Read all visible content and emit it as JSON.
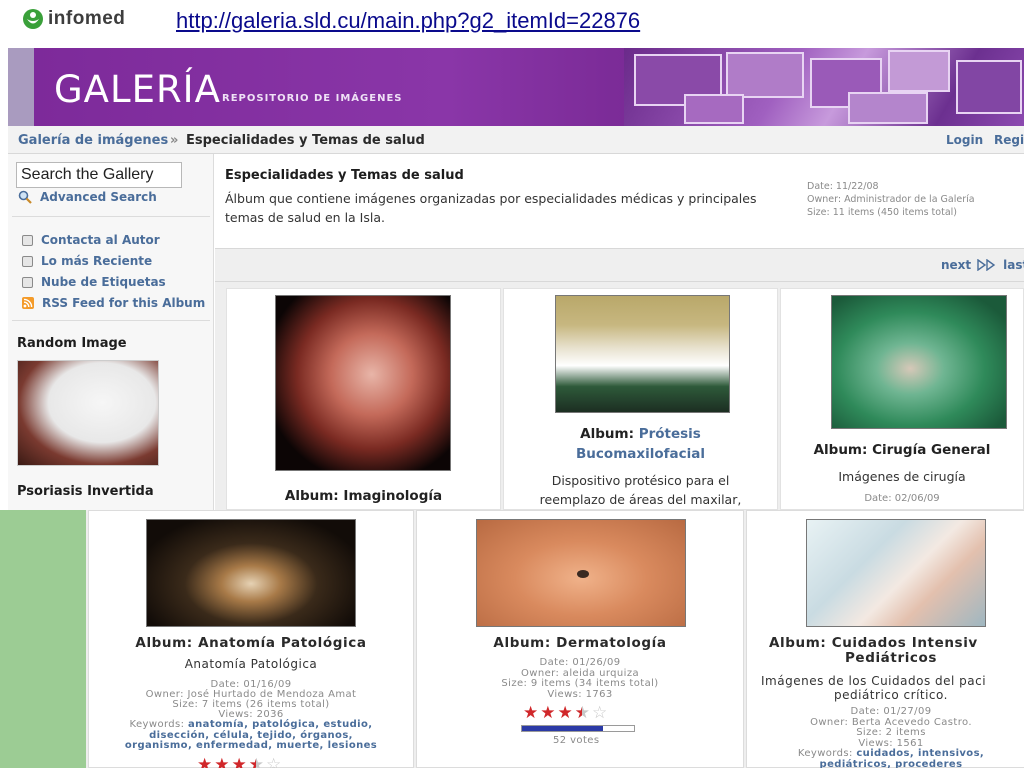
{
  "slide": {
    "logo_text": "infomed",
    "url": "http://galeria.sld.cu/main.php?g2_itemId=22876"
  },
  "banner": {
    "title": "GALERÍA",
    "subtitle": "REPOSITORIO DE IMÁGENES"
  },
  "breadcrumb": {
    "root": "Galería de imágenes",
    "separator": "»",
    "current": "Especialidades y Temas de salud"
  },
  "header_links": {
    "login": "Login",
    "register": "Regi"
  },
  "sidebar": {
    "search_value": "Search the Gallery",
    "advanced_search": "Advanced Search",
    "items": [
      {
        "label": "Contacta al Autor",
        "icon": "page-icon"
      },
      {
        "label": "Lo más Reciente",
        "icon": "page-icon"
      },
      {
        "label": "Nube de Etiquetas",
        "icon": "page-icon"
      },
      {
        "label": "RSS Feed for this Album",
        "icon": "rss-icon"
      }
    ],
    "random_image_heading": "Random Image",
    "random_image_caption": "Psoriasis Invertida"
  },
  "album": {
    "title": "Especialidades y Temas de salud",
    "description": "Álbum que contiene imágenes organizadas por especialidades médicas y principales temas de salud en la Isla.",
    "date": "Date: 11/22/08",
    "owner": "Owner: Administrador de la Galería",
    "size": "Size: 11 items (450 items total)"
  },
  "pager": {
    "next": "next",
    "last": "last"
  },
  "grid_top": [
    {
      "prefix": "Album:",
      "name": "Imaginología",
      "link": false
    },
    {
      "prefix": "Album:",
      "name": "Prótesis Bucomaxilofacial",
      "link": true,
      "name_line1": "Prótesis",
      "name_line2": "Bucomaxilofacial",
      "desc_line1": "Dispositivo protésico para el",
      "desc_line2": "reemplazo de áreas del maxilar,"
    },
    {
      "prefix": "Album:",
      "name": "Cirugía General",
      "link": false,
      "desc": "Imágenes de cirugía",
      "date": "Date: 02/06/09"
    }
  ],
  "grid_bottom": [
    {
      "title": "Album: Anatomía Patológica",
      "subtitle": "Anatomía Patológica",
      "date": "Date: 01/16/09",
      "owner": "Owner: José Hurtado de Mendoza Amat",
      "size": "Size: 7 items (26 items total)",
      "views": "Views: 2036",
      "keywords_label": "Keywords:",
      "keywords_line1": "anatomía, patológica, estudio,",
      "keywords_line2": "disección, célula, tejido, órganos,",
      "keywords_line3": "organismo, enfermedad, muerte, lesiones",
      "rating": 3.5
    },
    {
      "title": "Album: Dermatología",
      "date": "Date: 01/26/09",
      "owner": "Owner: aleida urquiza",
      "size": "Size: 9 items (34 items total)",
      "views": "Views: 1763",
      "rating": 3.5,
      "vote_fill": 0.72,
      "votes": "52 votes"
    },
    {
      "title_line1": "Album: Cuidados Intensiv",
      "title_line2": "Pediátricos",
      "desc_line1": "Imágenes de los Cuidados del paci",
      "desc_line2": "pediátrico crítico.",
      "date": "Date: 01/27/09",
      "owner": "Owner: Berta Acevedo Castro.",
      "size": "Size: 2 items",
      "views": "Views: 1561",
      "keywords_label": "Keywords:",
      "keywords_line1": "cuidados, intensivos,",
      "keywords_line2": "pediátricos, procederes"
    }
  ],
  "colors": {
    "banner_purple": "#7d2a9a",
    "link_blue": "#4a6d9a",
    "url_blue": "#0a0a8c",
    "star_red": "#d0272a",
    "slide_green": "#9ccc94"
  }
}
